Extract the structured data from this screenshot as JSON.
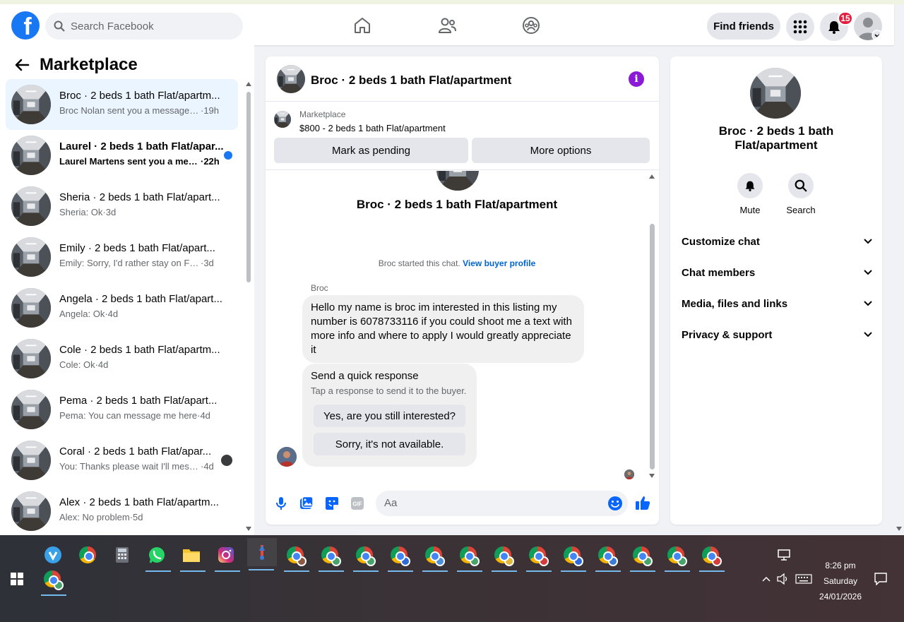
{
  "header": {
    "search_placeholder": "Search Facebook",
    "find_friends": "Find friends",
    "notifications_count": "15"
  },
  "sidebar": {
    "title": "Marketplace",
    "conversations": [
      {
        "title": "Broc · 2 beds 1 bath Flat/apartm...",
        "snippet": "Broc Nolan sent you a message a...",
        "time": "·19h",
        "active": true,
        "unread": false
      },
      {
        "title": "Laurel · 2 beds 1 bath Flat/apar...",
        "snippet": "Laurel Martens sent you a mes...",
        "time": "·22h",
        "unread": true
      },
      {
        "title": "Sheria · 2 beds 1 bath Flat/apart...",
        "snippet": "Sheria: Ok",
        "time": "·3d"
      },
      {
        "title": "Emily · 2 beds 1 bath Flat/apart...",
        "snippet": "Emily: Sorry, I'd rather stay on Face...",
        "time": "·3d"
      },
      {
        "title": "Angela · 2 beds 1 bath Flat/apart...",
        "snippet": "Angela: Ok",
        "time": "·4d"
      },
      {
        "title": "Cole · 2 beds 1 bath Flat/apartm...",
        "snippet": "Cole: Ok",
        "time": "·4d"
      },
      {
        "title": "Pema · 2 beds 1 bath Flat/apart...",
        "snippet": "Pema: You can message me here",
        "time": "·4d"
      },
      {
        "title": "Coral · 2 beds 1 bath Flat/apar...",
        "snippet": "You: Thanks please wait I'll mess...",
        "time": "·4d"
      },
      {
        "title": "Alex · 2 beds 1 bath Flat/apartm...",
        "snippet": "Alex: No problem",
        "time": "·5d"
      }
    ]
  },
  "chat": {
    "title": "Broc · 2 beds 1 bath Flat/apartment",
    "listing_source": "Marketplace",
    "listing_price": "$800 - 2 beds 1 bath Flat/apartment",
    "mark_pending": "Mark as pending",
    "more_options": "More options",
    "listing_name": "Broc · 2 beds 1 bath Flat/apartment",
    "started_text": "Broc started this chat.",
    "view_profile": "View buyer profile",
    "sender": "Broc",
    "message": "Hello my name is broc im interested in this listing my number is 6078733116 if you could shoot me a text with more info and where to apply I would greatly appreciate it",
    "quick_title": "Send a quick response",
    "quick_sub": "Tap a response to send it to the buyer.",
    "quick_options": [
      "Yes, are you still interested?",
      "Sorry, it's not available."
    ],
    "input_placeholder": "Aa"
  },
  "details": {
    "name": "Broc · 2 beds 1 bath Flat/apartment",
    "mute": "Mute",
    "search": "Search",
    "sections": [
      "Customize chat",
      "Chat members",
      "Media, files and links",
      "Privacy & support"
    ]
  },
  "taskbar": {
    "time": "8:26 pm",
    "day": "Saturday",
    "date": "24/01/2026"
  },
  "colors": {
    "brand": "#1877f2",
    "accent_purple": "#8b1ad6",
    "badge_red": "#e41e3f"
  }
}
